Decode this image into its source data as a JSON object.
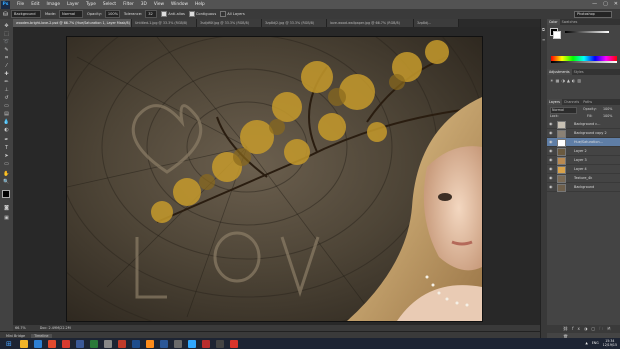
{
  "app": {
    "name": "Ps",
    "workspace": "Photoshop"
  },
  "menu": [
    "File",
    "Edit",
    "Image",
    "Layer",
    "Type",
    "Select",
    "Filter",
    "3D",
    "View",
    "Window",
    "Help"
  ],
  "window_controls": [
    "—",
    "▢",
    "✕"
  ],
  "options": {
    "sample": "Background",
    "mode_label": "Mode:",
    "mode_value": "Normal",
    "opacity_label": "Opacity:",
    "opacity_value": "100%",
    "tolerance_label": "Tolerance:",
    "tolerance_value": "32",
    "antialias_label": "Anti-alias",
    "contiguous_label": "Contiguous",
    "all_layers_label": "All Layers"
  },
  "tabs": [
    {
      "label": "wooden-bright-love-2.psd @ 66.7% (Hue/Saturation 1, Layer Mask/8)",
      "active": true
    },
    {
      "label": "Untitled-1.jpg @ 33.3% (RGB/8)",
      "active": false
    },
    {
      "label": "3sdjdf0f.jpg @ 33.3% (RGB/8)",
      "active": false
    },
    {
      "label": "3zp8dj2.jpg @ 33.3% (RGB/8)",
      "active": false
    },
    {
      "label": "love-wood-wallpaper.jpg @ 66.7% (RGB/8)",
      "active": false
    },
    {
      "label": "3zp8dj...",
      "active": false
    }
  ],
  "status": {
    "zoom": "66.7%",
    "doc": "Doc: 2.49M/22.2M"
  },
  "timeline_tabs": [
    "Mini Bridge",
    "Timeline"
  ],
  "panels": {
    "color_tabs": [
      "Color",
      "Swatches"
    ],
    "adjust_tabs": [
      "Adjustments",
      "Styles"
    ],
    "layer_tabs": [
      "Layers",
      "Channels",
      "Paths"
    ],
    "blend_mode": "Normal",
    "opacity_label": "Opacity:",
    "opacity_value": "100%",
    "lock_label": "Lock:",
    "fill_label": "Fill:",
    "fill_value": "100%",
    "layers": [
      {
        "name": "Background c...",
        "selected": false,
        "thumb": "#c7c0b3"
      },
      {
        "name": "Background copy 2",
        "selected": false,
        "thumb": "#8a8175"
      },
      {
        "name": "Hue/Saturation...",
        "selected": true,
        "thumb": "#ffffff"
      },
      {
        "name": "Layer 2",
        "selected": false,
        "thumb": "#6b5a3f"
      },
      {
        "name": "Layer 3",
        "selected": false,
        "thumb": "#b98a52"
      },
      {
        "name": "Layer 4",
        "selected": false,
        "thumb": "#d8a24a"
      },
      {
        "name": "Texture_4k",
        "selected": false,
        "thumb": "#7a6a55"
      },
      {
        "name": "Background",
        "selected": false,
        "thumb": "#6f604c"
      }
    ]
  },
  "tray": {
    "lang": "ENG",
    "time": "15:34",
    "date": "12/19/15"
  },
  "colors": {
    "accent": "#5f7ea6",
    "ps_blue": "#31a8ff"
  }
}
